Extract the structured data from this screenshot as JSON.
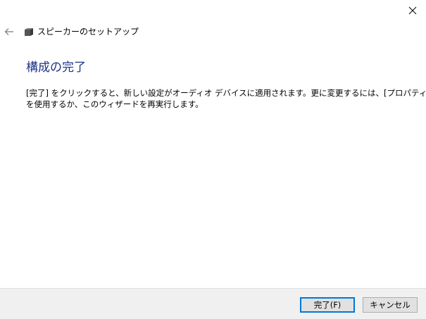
{
  "window": {
    "title": "スピーカーのセットアップ"
  },
  "page": {
    "heading": "構成の完了",
    "description_lines": [
      "[完了] をクリックすると、新しい設定がオーディオ デバイスに適用されます。更に変更するには、[プロパティ]",
      "を使用するか、このウィザードを再実行します。"
    ]
  },
  "buttons": {
    "finish": "完了(F)",
    "cancel": "キャンセル"
  },
  "icons": {
    "back": "back-arrow-icon",
    "close": "close-icon",
    "wizard": "speaker-icon"
  },
  "colors": {
    "heading": "#1e3287",
    "footer_bg": "#f0f0f0",
    "default_button_border": "#0078d7"
  }
}
